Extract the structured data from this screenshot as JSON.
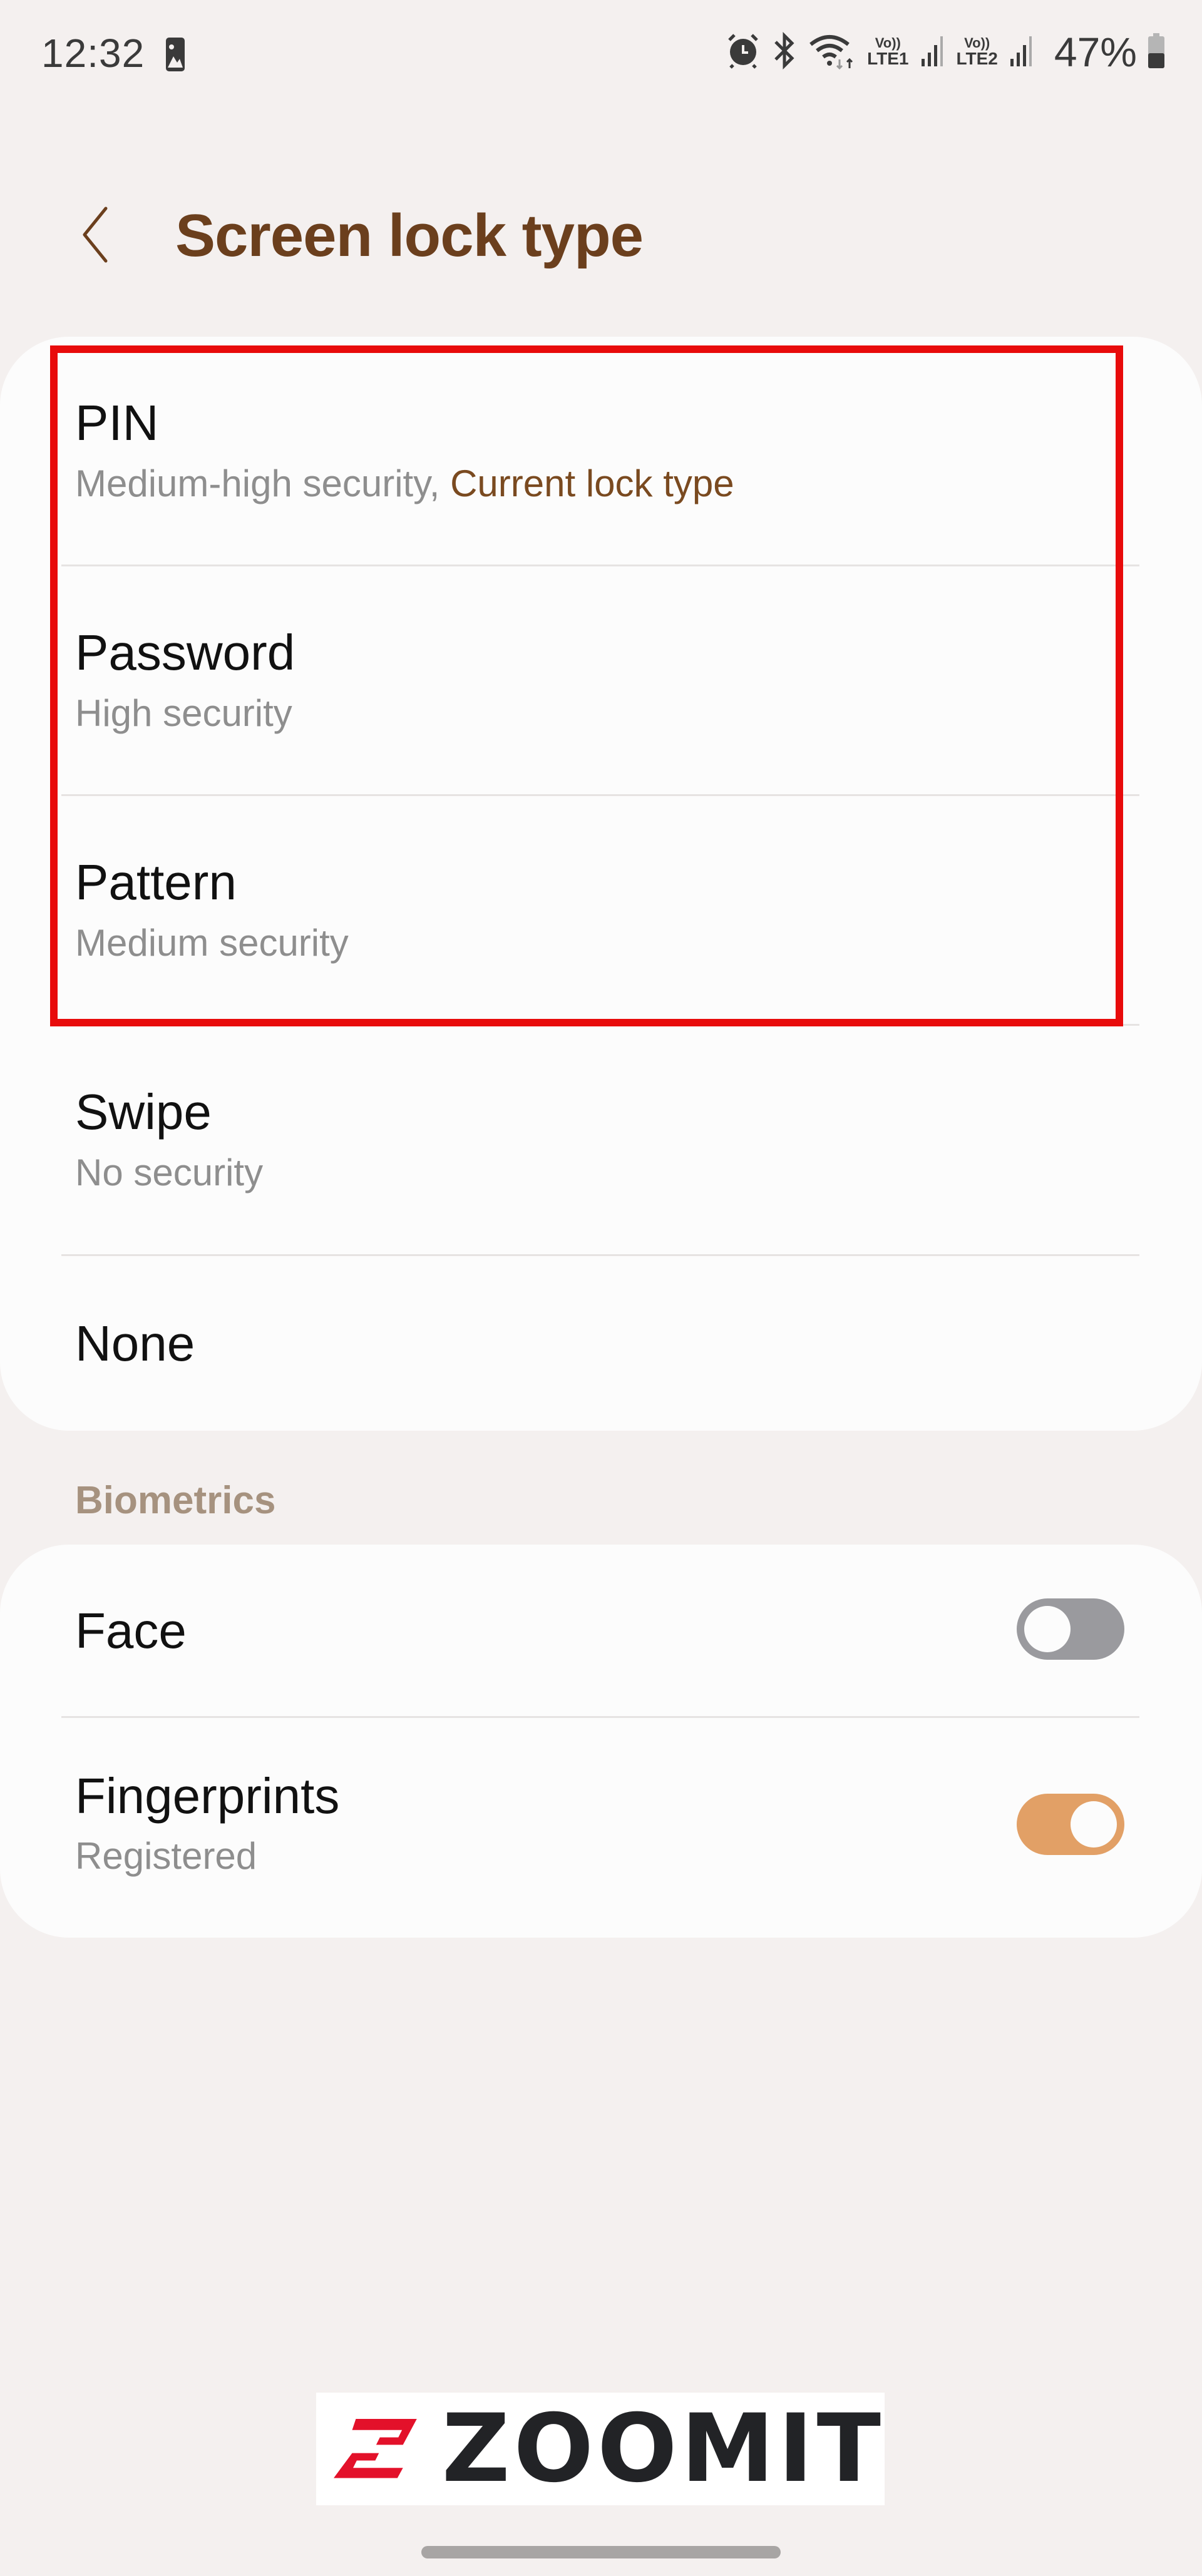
{
  "status_bar": {
    "time": "12:32",
    "notification_icons": [
      "gallery-icon"
    ],
    "system_icons": [
      "alarm-icon",
      "bluetooth-icon",
      "wifi-icon"
    ],
    "sim1": {
      "vo": "Vo))",
      "label": "LTE1"
    },
    "sim2": {
      "vo": "Vo))",
      "label": "LTE2"
    },
    "battery_percent": "47%",
    "battery_level": 0.47
  },
  "header": {
    "back_icon": "chevron-left-icon",
    "title": "Screen lock type"
  },
  "lock_types": [
    {
      "title": "PIN",
      "subtitle": "Medium-high security, ",
      "subtitle_accent": "Current lock type",
      "current": true
    },
    {
      "title": "Password",
      "subtitle": "High security"
    },
    {
      "title": "Pattern",
      "subtitle": "Medium security"
    },
    {
      "title": "Swipe",
      "subtitle": "No security"
    },
    {
      "title": "None"
    }
  ],
  "biometrics": {
    "section_label": "Biometrics",
    "items": [
      {
        "title": "Face",
        "toggle_on": false
      },
      {
        "title": "Fingerprints",
        "subtitle": "Registered",
        "toggle_on": true
      }
    ]
  },
  "colors": {
    "accent_brown": "#6b3f1d",
    "toggle_on": "#e2a066",
    "toggle_off": "#9a9a9e",
    "highlight_red": "#e80b0b"
  },
  "watermark": {
    "text": "ZOOMIT"
  }
}
